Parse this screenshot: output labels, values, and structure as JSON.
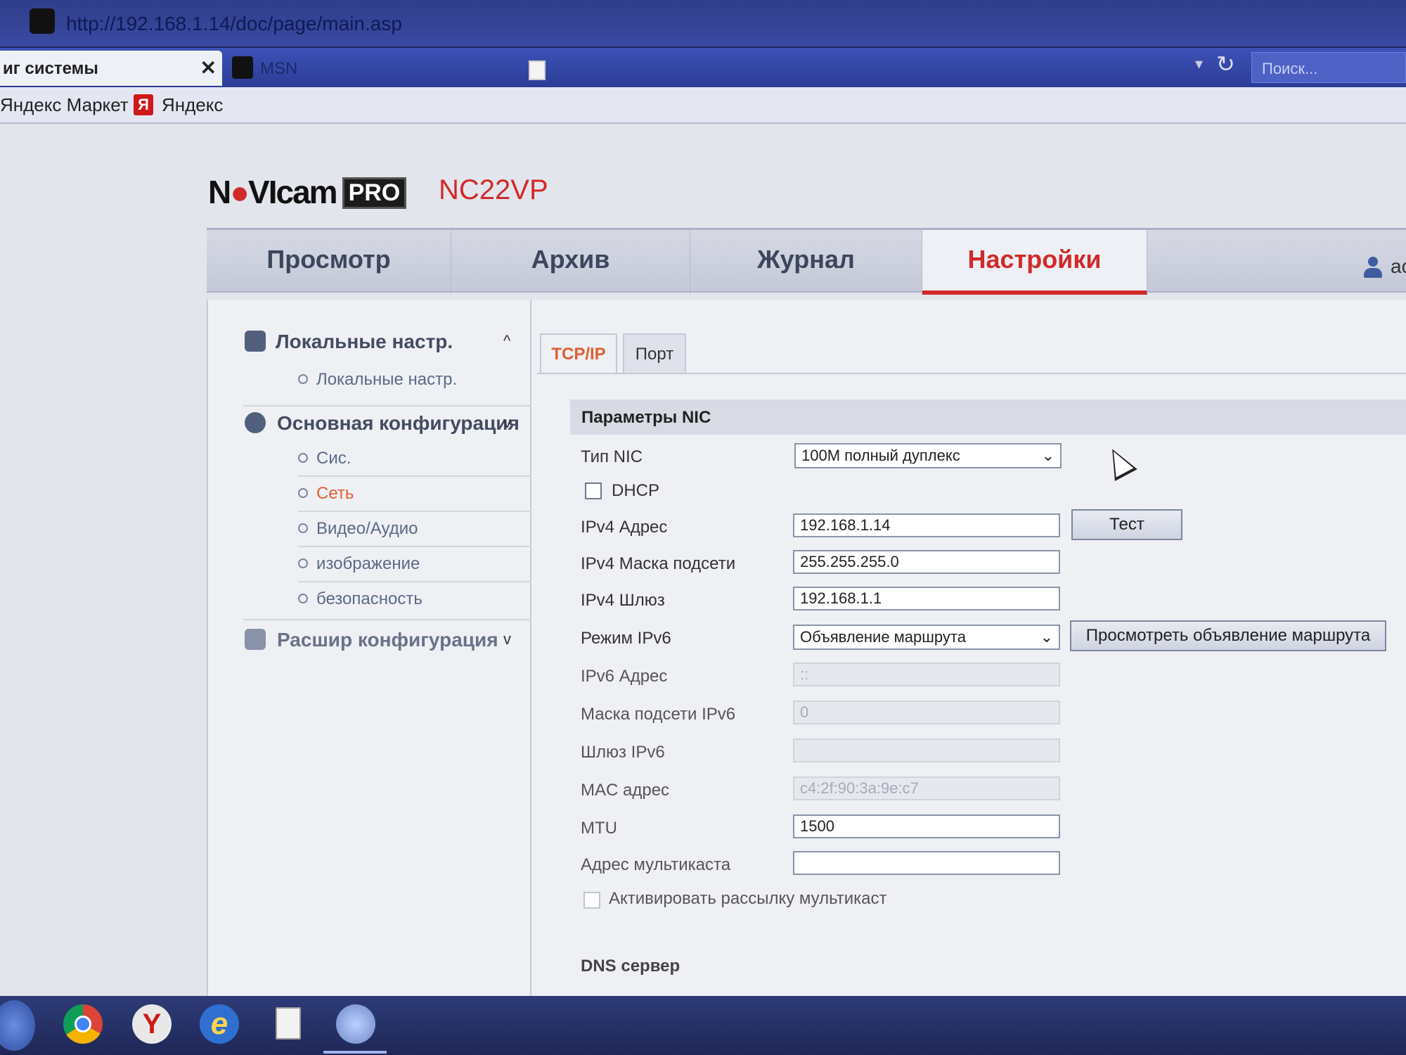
{
  "browser": {
    "url": "http://192.168.1.14/doc/page/main.asp",
    "active_tab_label": "иг системы",
    "tab_close": "✕",
    "second_tab_label": "MSN",
    "search_placeholder": "Поиск...",
    "dropdown_glyph": "▾",
    "reload_glyph": "↻",
    "favorites": [
      "Яндекс Маркет",
      "Яндекс"
    ],
    "yandex_glyph": "Я"
  },
  "header": {
    "brand_prefix": "N",
    "brand_o": "●",
    "brand_mid": "VI",
    "brand_cam": "cam",
    "brand_pro": "PRO",
    "model": "NC22VP"
  },
  "nav": {
    "tabs": [
      "Просмотр",
      "Архив",
      "Журнал",
      "Настройки"
    ],
    "active": "Настройки",
    "user": "ac"
  },
  "sidebar": {
    "local": {
      "label": "Локальные настр.",
      "chevron": "^",
      "items": [
        "Локальные настр."
      ]
    },
    "basic": {
      "label": "Основная конфигурация",
      "chevron": "v",
      "items": [
        "Сис.",
        "Сеть",
        "Видео/Аудио",
        "изображение",
        "безопасность"
      ],
      "active": "Сеть"
    },
    "advanced": {
      "label": "Расшир конфигурация",
      "chevron": "v"
    }
  },
  "subtabs": [
    "TCP/IP",
    "Порт"
  ],
  "form": {
    "section_title": "Параметры NIC",
    "nic_type": {
      "label": "Тип NIC",
      "value": "100M полный дуплекс"
    },
    "dhcp": {
      "label": "DHCP",
      "checked": false
    },
    "ipv4_addr": {
      "label": "IPv4 Адрес",
      "value": "192.168.1.14"
    },
    "test_button": "Тест",
    "ipv4_mask": {
      "label": "IPv4 Маска подсети",
      "value": "255.255.255.0"
    },
    "ipv4_gw": {
      "label": "IPv4 Шлюз",
      "value": "192.168.1.1"
    },
    "ipv6_mode": {
      "label": "Режим IPv6",
      "value": "Объявление маршрута"
    },
    "view_route_button": "Просмотреть объявление маршрута",
    "ipv6_addr": {
      "label": "IPv6 Адрес",
      "value": "::"
    },
    "ipv6_mask": {
      "label": "Маска подсети IPv6",
      "value": "0"
    },
    "ipv6_gw": {
      "label": "Шлюз IPv6",
      "value": ""
    },
    "mac": {
      "label": "MAC адрес",
      "value": "c4:2f:90:3a:9e:c7"
    },
    "mtu": {
      "label": "MTU",
      "value": "1500"
    },
    "multicast_addr": {
      "label": "Адрес мультикаста",
      "value": ""
    },
    "multicast_enable": {
      "label": "Активировать рассылку мультикаст",
      "checked": false
    },
    "dns_title": "DNS сервер"
  },
  "taskbar": {
    "yandex_glyph": "Y",
    "ie_glyph": "e"
  },
  "colors": {
    "accent": "#d12a2a",
    "active_item": "#e06030",
    "browser_blue": "#3a4aa3",
    "taskbar": "#1e2756"
  }
}
